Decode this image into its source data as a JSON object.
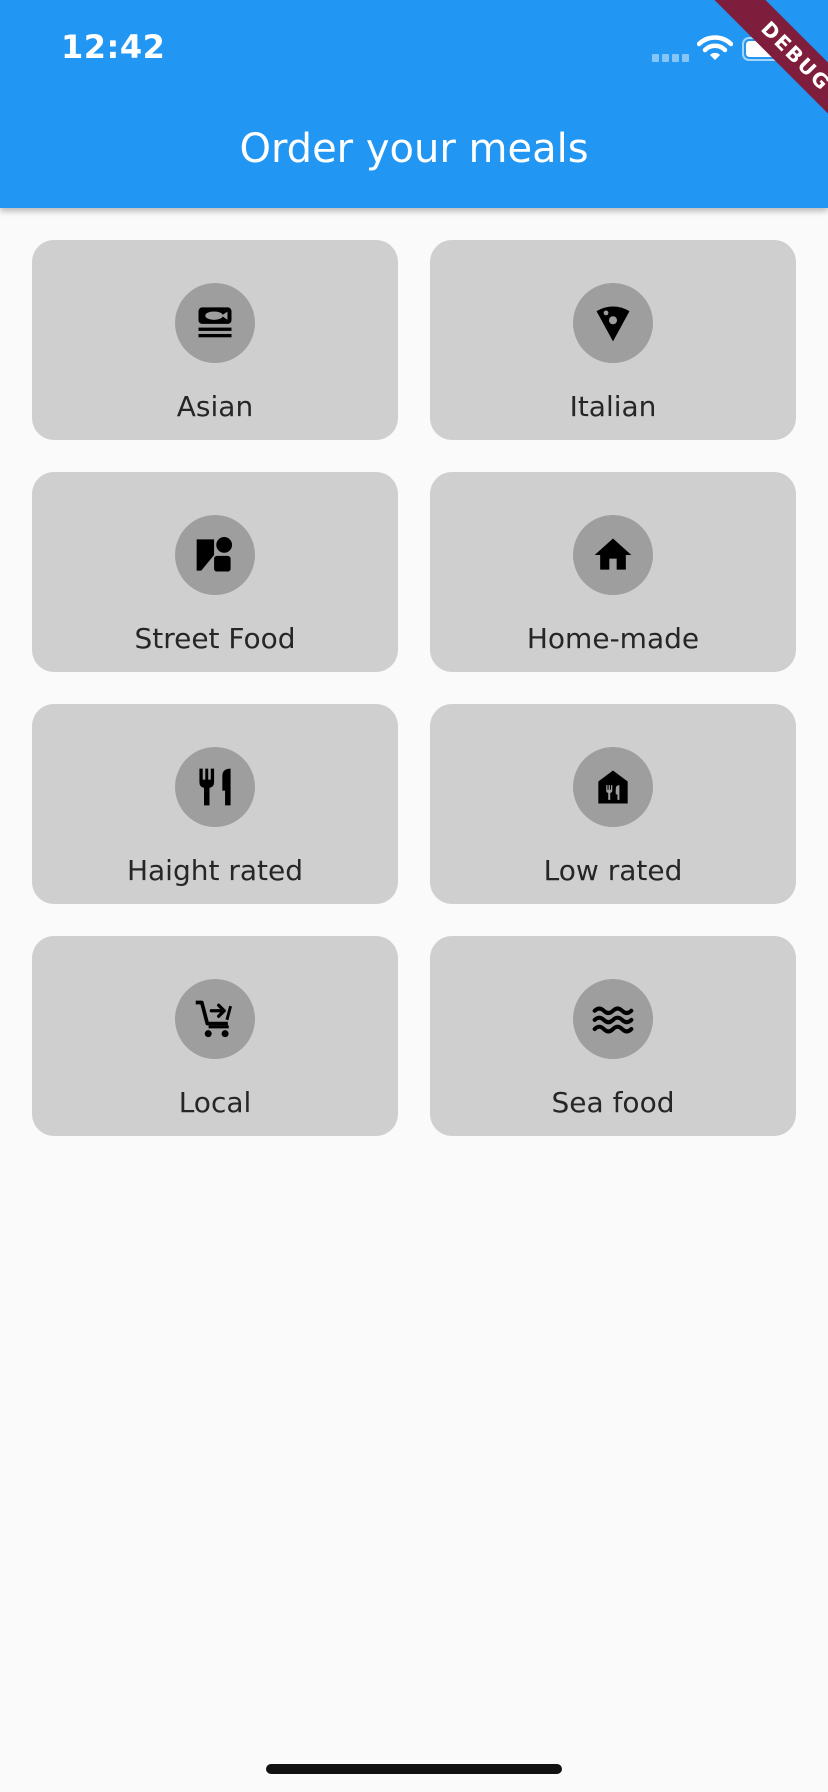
{
  "status_bar": {
    "time": "12:42"
  },
  "debug_banner": "DEBUG",
  "app_bar": {
    "title": "Order your meals"
  },
  "categories": [
    {
      "label": "Asian",
      "icon": "set-meal-icon"
    },
    {
      "label": "Italian",
      "icon": "pizza-slice-icon"
    },
    {
      "label": "Street Food",
      "icon": "category-shapes-icon"
    },
    {
      "label": "Home-made",
      "icon": "house-icon"
    },
    {
      "label": "Haight rated",
      "icon": "fork-knife-icon"
    },
    {
      "label": "Low rated",
      "icon": "restaurant-building-icon"
    },
    {
      "label": "Local",
      "icon": "add-to-cart-icon"
    },
    {
      "label": "Sea food",
      "icon": "waves-icon"
    }
  ],
  "colors": {
    "app_bar": "#2196f3",
    "card": "#cfcfcf",
    "avatar": "#9e9e9e",
    "background": "#fafafa",
    "debug_banner": "#7f1d3c"
  }
}
